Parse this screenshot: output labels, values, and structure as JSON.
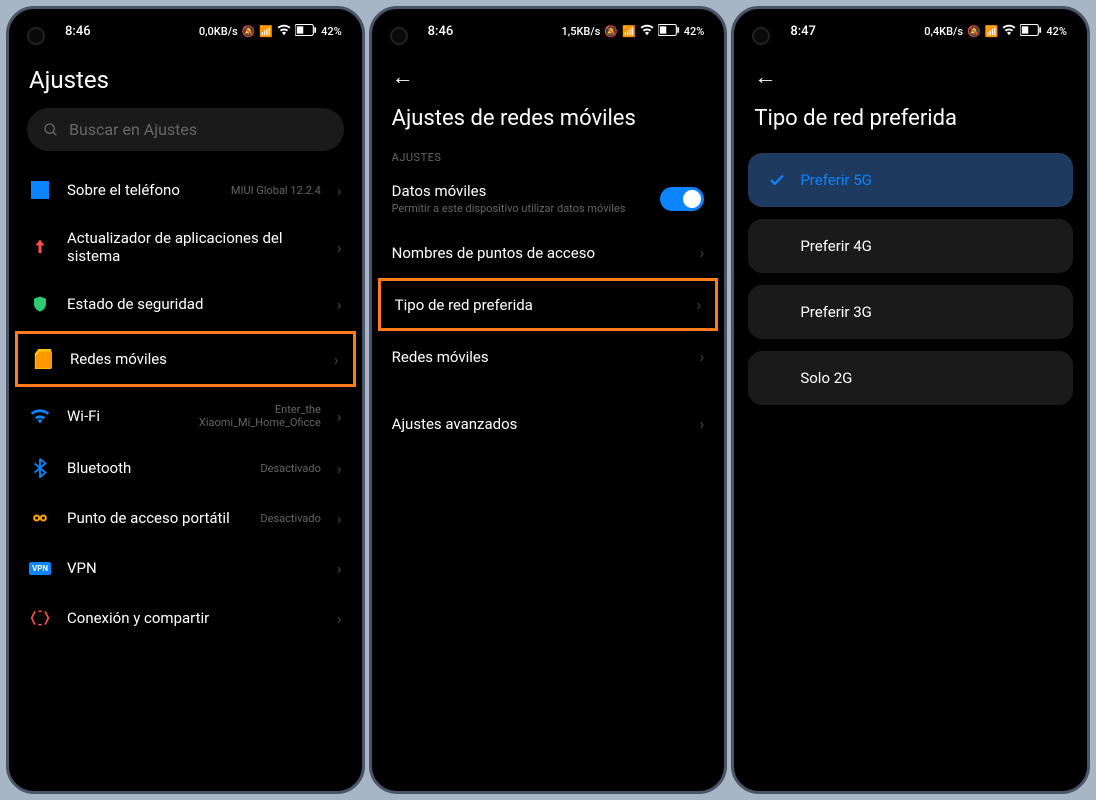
{
  "screens": [
    {
      "status": {
        "time": "8:46",
        "data_rate": "0,0KB/s",
        "battery": "42%"
      },
      "title": "Ajustes",
      "search_placeholder": "Buscar en Ajustes",
      "items": [
        {
          "label": "Sobre el teléfono",
          "value": "MIUI Global 12.2.4"
        },
        {
          "label": "Actualizador de aplicaciones del sistema",
          "value": ""
        },
        {
          "label": "Estado de seguridad",
          "value": ""
        },
        {
          "label": "Redes móviles",
          "value": ""
        },
        {
          "label": "Wi-Fi",
          "value_top": "Enter_the",
          "value_bottom": "Xiaomi_Mi_Home_Oficce"
        },
        {
          "label": "Bluetooth",
          "value": "Desactivado"
        },
        {
          "label": "Punto de acceso portátil",
          "value": "Desactivado"
        },
        {
          "label": "VPN",
          "value": ""
        },
        {
          "label": "Conexión y compartir",
          "value": ""
        }
      ]
    },
    {
      "status": {
        "time": "8:46",
        "data_rate": "1,5KB/s",
        "battery": "42%"
      },
      "title": "Ajustes de redes móviles",
      "section": "AJUSTES",
      "items": [
        {
          "label": "Datos móviles",
          "desc": "Permitir a este dispositivo utilizar datos móviles"
        },
        {
          "label": "Nombres de puntos de acceso"
        },
        {
          "label": "Tipo de red preferida"
        },
        {
          "label": "Redes móviles"
        },
        {
          "label": "Ajustes avanzados"
        }
      ]
    },
    {
      "status": {
        "time": "8:47",
        "data_rate": "0,4KB/s",
        "battery": "42%"
      },
      "title": "Tipo de red preferida",
      "options": [
        {
          "label": "Preferir 5G",
          "selected": true
        },
        {
          "label": "Preferir 4G",
          "selected": false
        },
        {
          "label": "Preferir 3G",
          "selected": false
        },
        {
          "label": "Solo 2G",
          "selected": false
        }
      ]
    }
  ]
}
